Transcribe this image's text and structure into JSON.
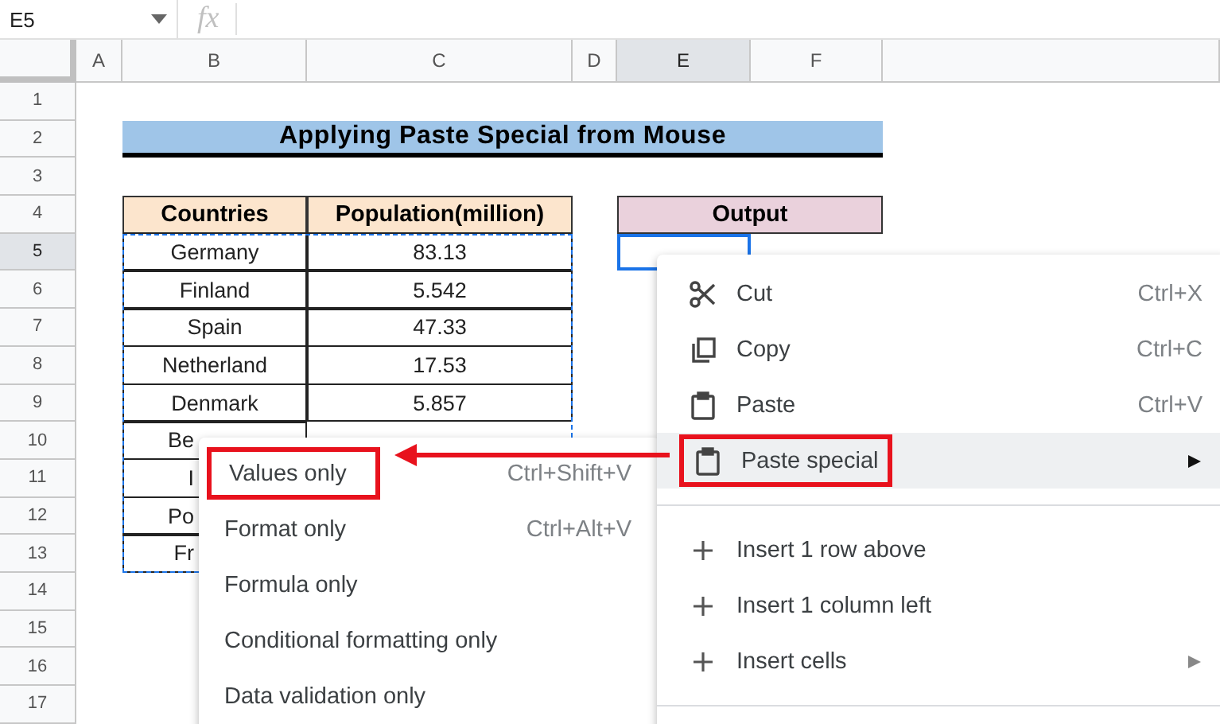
{
  "formula_bar": {
    "name_box": "E5",
    "formula_label": "fx"
  },
  "columns": [
    {
      "label": "A",
      "selected": false
    },
    {
      "label": "B",
      "selected": false
    },
    {
      "label": "C",
      "selected": false
    },
    {
      "label": "D",
      "selected": false
    },
    {
      "label": "E",
      "selected": true
    },
    {
      "label": "F",
      "selected": false
    }
  ],
  "rows": [
    {
      "label": "1",
      "selected": false
    },
    {
      "label": "2",
      "selected": false
    },
    {
      "label": "3",
      "selected": false
    },
    {
      "label": "4",
      "selected": false
    },
    {
      "label": "5",
      "selected": true
    },
    {
      "label": "6",
      "selected": false
    },
    {
      "label": "7",
      "selected": false
    },
    {
      "label": "8",
      "selected": false
    },
    {
      "label": "9",
      "selected": false
    },
    {
      "label": "10",
      "selected": false
    },
    {
      "label": "11",
      "selected": false
    },
    {
      "label": "12",
      "selected": false
    },
    {
      "label": "13",
      "selected": false
    },
    {
      "label": "14",
      "selected": false
    },
    {
      "label": "15",
      "selected": false
    },
    {
      "label": "16",
      "selected": false
    },
    {
      "label": "17",
      "selected": false
    }
  ],
  "title": "Applying Paste Special from Mouse",
  "table": {
    "headers": [
      "Countries",
      "Population(million)"
    ],
    "rows": [
      {
        "country": "Germany",
        "population": "83.13"
      },
      {
        "country": "Finland",
        "population": "5.542"
      },
      {
        "country": "Spain",
        "population": "47.33"
      },
      {
        "country": "Netherland",
        "population": "17.53"
      },
      {
        "country": "Denmark",
        "population": "5.857"
      },
      {
        "country": "Be"
      },
      {
        "country": "I"
      },
      {
        "country": "Po"
      },
      {
        "country": "Fr"
      }
    ]
  },
  "output": {
    "header": "Output"
  },
  "context_menu": {
    "items": [
      {
        "kind": "scissors",
        "label": "Cut",
        "shortcut": "Ctrl+X",
        "highlighted": false,
        "annotated": false,
        "submenu": false
      },
      {
        "kind": "copy",
        "label": "Copy",
        "shortcut": "Ctrl+C",
        "highlighted": false,
        "annotated": false,
        "submenu": false
      },
      {
        "kind": "clipboard",
        "label": "Paste",
        "shortcut": "Ctrl+V",
        "highlighted": false,
        "annotated": false,
        "submenu": false
      },
      {
        "kind": "clipboard",
        "label": "Paste special",
        "highlighted": true,
        "annotated": true,
        "submenu": true
      },
      {
        "kind": "divider"
      },
      {
        "kind": "plus",
        "label": "Insert 1 row above",
        "highlighted": false,
        "annotated": false,
        "submenu": false
      },
      {
        "kind": "plus",
        "label": "Insert 1 column left",
        "highlighted": false,
        "annotated": false,
        "submenu": false
      },
      {
        "kind": "plus",
        "label": "Insert cells",
        "highlighted": false,
        "annotated": false,
        "submenu": true
      },
      {
        "kind": "divider"
      }
    ]
  },
  "submenu": {
    "items": [
      {
        "label": "Values only",
        "shortcut": "Ctrl+Shift+V",
        "annotated": true
      },
      {
        "label": "Format only",
        "shortcut": "Ctrl+Alt+V",
        "annotated": false
      },
      {
        "label": "Formula only",
        "annotated": false
      },
      {
        "label": "Conditional formatting only",
        "annotated": false
      },
      {
        "label": "Data validation only",
        "annotated": false
      }
    ]
  }
}
